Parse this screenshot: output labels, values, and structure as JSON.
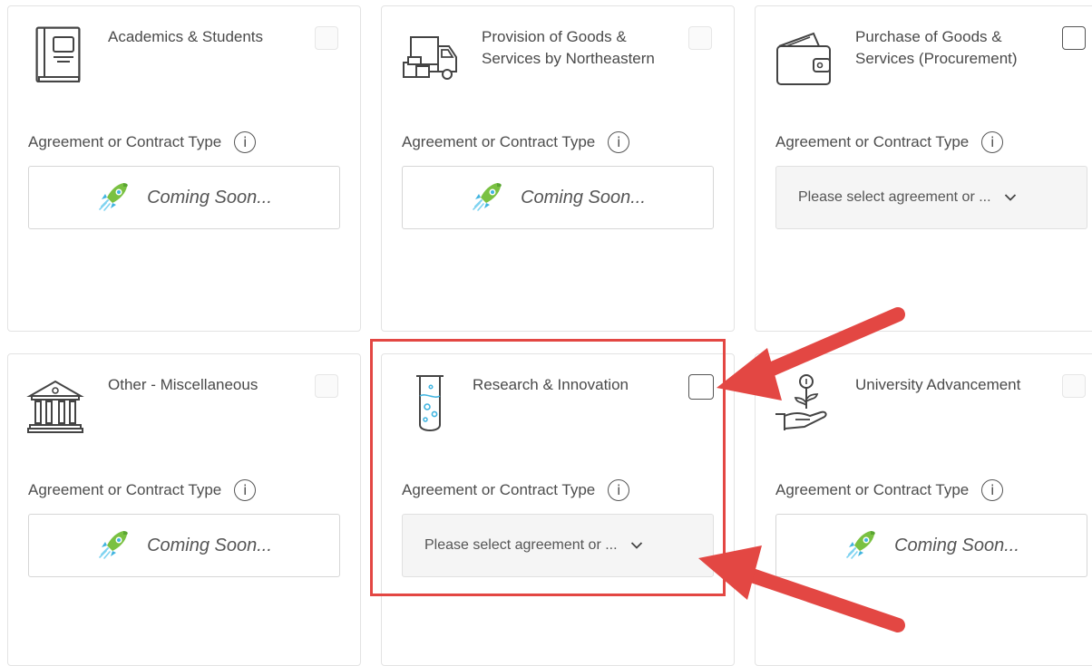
{
  "colors": {
    "annotation": "#e34743",
    "rocket_green": "#7ac142",
    "rocket_blue": "#40b4e0"
  },
  "cards": [
    {
      "title": "Academics & Students",
      "icon": "book-icon",
      "type_label": "Agreement or Contract Type",
      "info": "i",
      "contract": {
        "kind": "coming-soon",
        "text": "Coming Soon..."
      }
    },
    {
      "title": "Provision of Goods & Services by Northeastern",
      "icon": "delivery-truck-icon",
      "type_label": "Agreement or Contract Type",
      "info": "i",
      "contract": {
        "kind": "coming-soon",
        "text": "Coming Soon..."
      }
    },
    {
      "title": "Purchase of Goods & Services (Procurement)",
      "icon": "wallet-icon",
      "type_label": "Agreement or Contract Type",
      "info": "i",
      "contract": {
        "kind": "select",
        "text": "Please select agreement or ..."
      }
    },
    {
      "title": "Other - Miscellaneous",
      "icon": "building-icon",
      "type_label": "Agreement or Contract Type",
      "info": "i",
      "contract": {
        "kind": "coming-soon",
        "text": "Coming Soon..."
      }
    },
    {
      "title": "Research & Innovation",
      "icon": "test-tube-icon",
      "type_label": "Agreement or Contract Type",
      "info": "i",
      "contract": {
        "kind": "select",
        "text": "Please select agreement or ..."
      }
    },
    {
      "title": "University Advancement",
      "icon": "hand-plant-icon",
      "type_label": "Agreement or Contract Type",
      "info": "i",
      "contract": {
        "kind": "coming-soon",
        "text": "Coming Soon..."
      }
    }
  ]
}
